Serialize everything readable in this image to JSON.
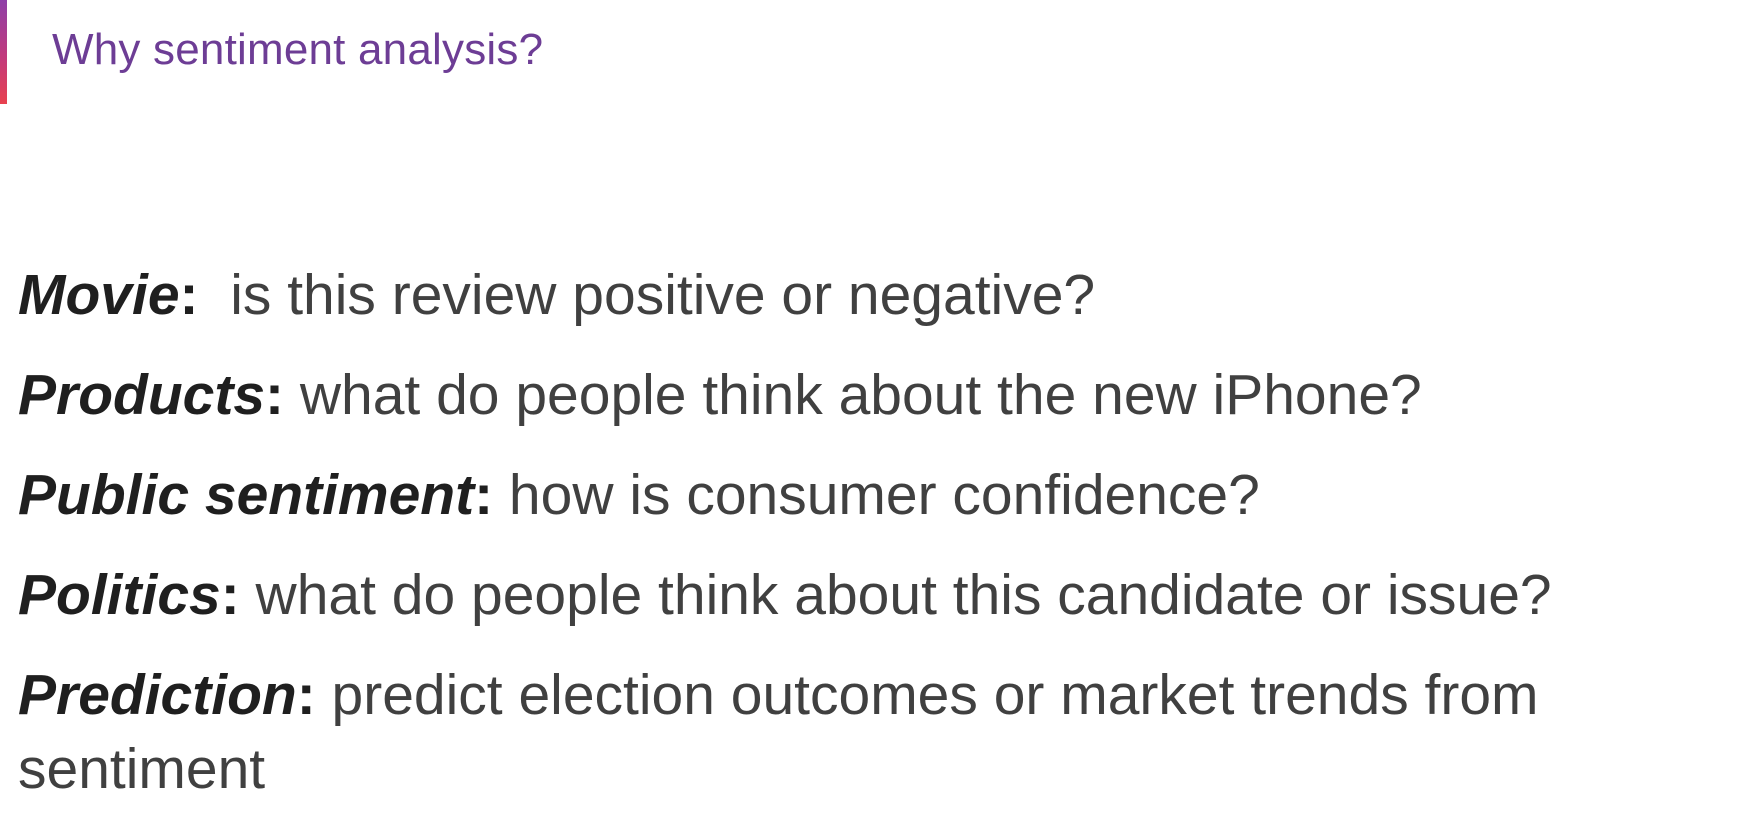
{
  "slide": {
    "title": "Why sentiment analysis?",
    "accent_colors": [
      "#8e3fa8",
      "#c23a7c",
      "#e8414f"
    ],
    "title_color": "#6d3d95"
  },
  "bullets": [
    {
      "term": "Movie",
      "colon": ":",
      "text": "  is this review positive or negative?"
    },
    {
      "term": "Products",
      "colon": ":",
      "text": " what do people think about the new iPhone?"
    },
    {
      "term": "Public sentiment",
      "colon": ":",
      "text": " how is consumer confidence?"
    },
    {
      "term": "Politics",
      "colon": ":",
      "text": " what do people think about this candidate or issue?"
    },
    {
      "term": "Prediction",
      "colon": ":",
      "text": " predict election outcomes or market trends from sentiment"
    }
  ]
}
